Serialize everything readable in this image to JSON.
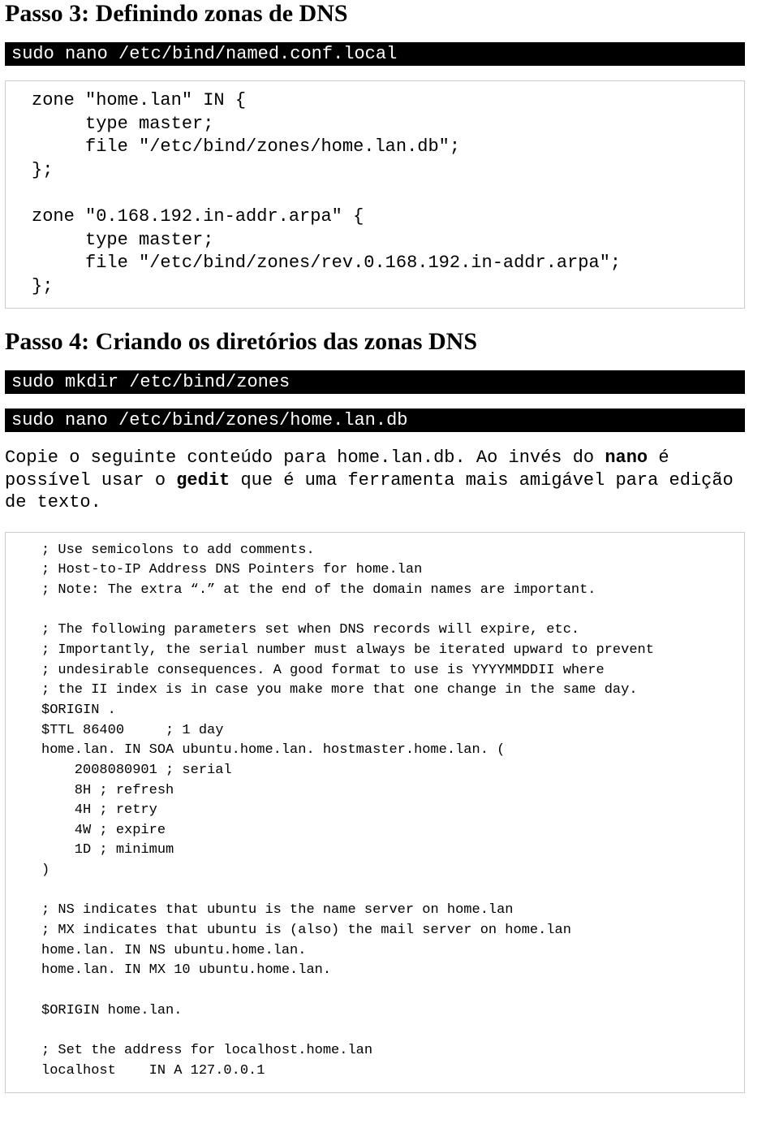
{
  "step3": {
    "heading": "Passo 3: Definindo zonas de DNS",
    "cmd1": "sudo nano /etc/bind/named.conf.local",
    "code": "zone \"home.lan\" IN {\n     type master;\n     file \"/etc/bind/zones/home.lan.db\";\n};\n\nzone \"0.168.192.in-addr.arpa\" {\n     type master;\n     file \"/etc/bind/zones/rev.0.168.192.in-addr.arpa\";\n};"
  },
  "step4": {
    "heading": "Passo 4: Criando os diretórios das zonas DNS",
    "cmd1": "sudo mkdir /etc/bind/zones",
    "cmd2": "sudo nano /etc/bind/zones/home.lan.db",
    "bodytext": {
      "t1": "Copie o seguinte conteúdo para home.lan.db. Ao invés do ",
      "b1": "nano",
      "t2": " é possível usar o ",
      "b2": "gedit",
      "t3": " que é uma ferramenta mais amigável para edição de texto."
    },
    "code": "; Use semicolons to add comments.\n; Host-to-IP Address DNS Pointers for home.lan\n; Note: The extra “.” at the end of the domain names are important.\n\n; The following parameters set when DNS records will expire, etc.\n; Importantly, the serial number must always be iterated upward to prevent\n; undesirable consequences. A good format to use is YYYYMMDDII where\n; the II index is in case you make more that one change in the same day.\n$ORIGIN .\n$TTL 86400     ; 1 day\nhome.lan. IN SOA ubuntu.home.lan. hostmaster.home.lan. (\n    2008080901 ; serial\n    8H ; refresh\n    4H ; retry\n    4W ; expire\n    1D ; minimum\n)\n\n; NS indicates that ubuntu is the name server on home.lan\n; MX indicates that ubuntu is (also) the mail server on home.lan\nhome.lan. IN NS ubuntu.home.lan.\nhome.lan. IN MX 10 ubuntu.home.lan.\n\n$ORIGIN home.lan.\n\n; Set the address for localhost.home.lan\nlocalhost    IN A 127.0.0.1"
  }
}
